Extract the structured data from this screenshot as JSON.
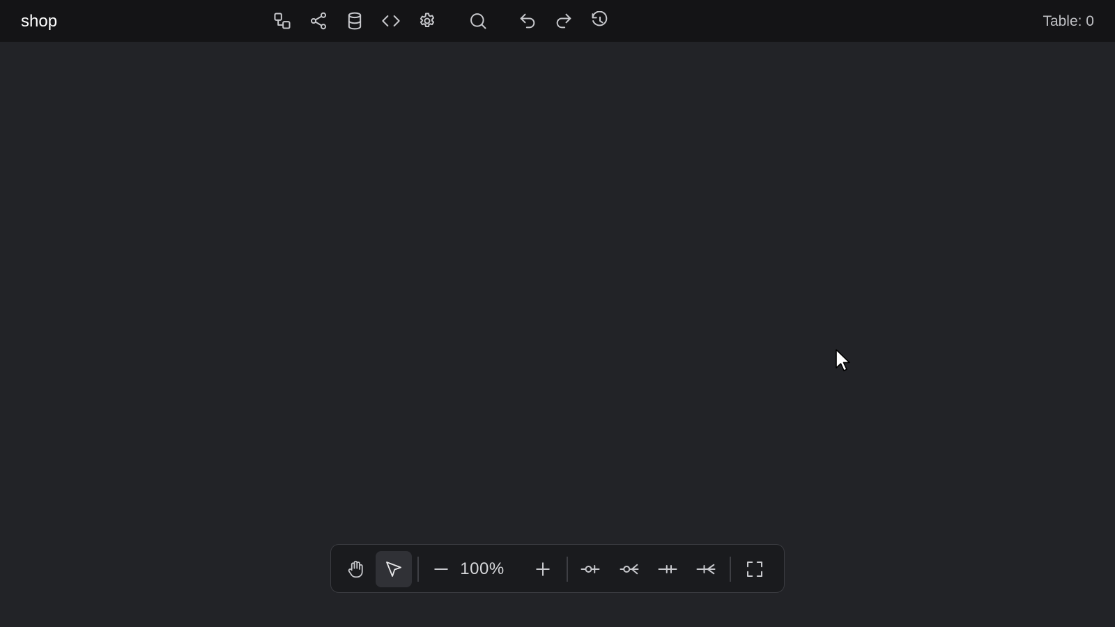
{
  "header": {
    "title": "shop",
    "table_count_label": "Table: 0"
  },
  "toolbar_icons": [
    "diagram-icon",
    "share-icon",
    "database-icon",
    "code-icon",
    "settings-icon",
    "search-icon",
    "undo-icon",
    "redo-icon",
    "history-icon"
  ],
  "bottom_toolbar": {
    "tools": [
      "hand-tool-icon",
      "select-tool-icon"
    ],
    "active_tool": "select-tool-icon",
    "zoom_out_icon": "minus-icon",
    "zoom_level": "100%",
    "zoom_in_icon": "plus-icon",
    "relation_icons": [
      "relation-one-icon",
      "relation-many-icon",
      "relation-one-one-icon",
      "relation-one-many-icon"
    ],
    "fullscreen_icon": "fullscreen-icon"
  },
  "colors": {
    "topbar_bg": "#141416",
    "canvas_bg": "#222327",
    "icon_color": "#c8c9cd",
    "active_tool_bg": "#303136"
  }
}
